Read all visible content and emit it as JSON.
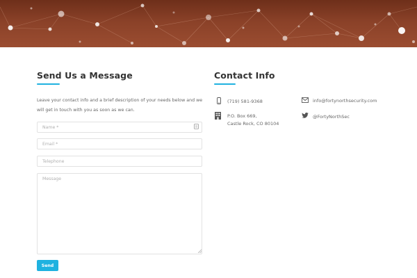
{
  "form": {
    "title": "Send Us a Message",
    "intro": "Leave your contact info and a brief description of your needs below and we will get in touch with you as soon as we can.",
    "name_placeholder": "Name *",
    "email_placeholder": "Email *",
    "telephone_placeholder": "Telephone",
    "message_placeholder": "Message",
    "send_label": "Send"
  },
  "contact": {
    "title": "Contact Info",
    "phone": "(719) 581-9368",
    "address_line1": "P.O. Box 669,",
    "address_line2": "Castle Rock, CO 80104",
    "email": "info@fortynorthsecurity.com",
    "twitter": "@FortyNorthSec"
  },
  "colors": {
    "accent": "#1fb2e0",
    "hero": "#8a4128",
    "heading": "#333333"
  }
}
